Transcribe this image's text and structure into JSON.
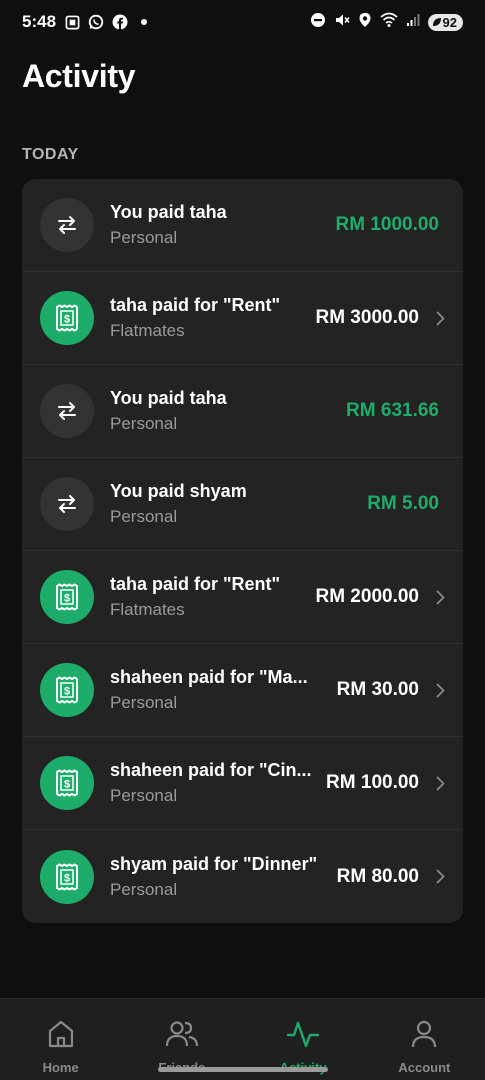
{
  "status_bar": {
    "time": "5:48",
    "battery": "92"
  },
  "page": {
    "title": "Activity",
    "section": "TODAY"
  },
  "colors": {
    "accent": "#1eac6a",
    "background": "#0f0f0f",
    "card": "#232323"
  },
  "activities": [
    {
      "icon": "transfer-icon",
      "title": "You paid taha",
      "subtitle": "Personal",
      "amount": "RM 1000.00",
      "amount_color": "green",
      "chevron": false
    },
    {
      "icon": "receipt-icon",
      "title": "taha paid for \"Rent\"",
      "subtitle": "Flatmates",
      "amount": "RM 3000.00",
      "amount_color": "white",
      "chevron": true
    },
    {
      "icon": "transfer-icon",
      "title": "You paid taha",
      "subtitle": "Personal",
      "amount": "RM 631.66",
      "amount_color": "green",
      "chevron": false
    },
    {
      "icon": "transfer-icon",
      "title": "You paid shyam",
      "subtitle": "Personal",
      "amount": "RM 5.00",
      "amount_color": "green",
      "chevron": false
    },
    {
      "icon": "receipt-icon",
      "title": "taha paid for \"Rent\"",
      "subtitle": "Flatmates",
      "amount": "RM 2000.00",
      "amount_color": "white",
      "chevron": true
    },
    {
      "icon": "receipt-icon",
      "title": "shaheen paid for \"Ma...",
      "subtitle": "Personal",
      "amount": "RM 30.00",
      "amount_color": "white",
      "chevron": true
    },
    {
      "icon": "receipt-icon",
      "title": "shaheen paid for \"Cin...",
      "subtitle": "Personal",
      "amount": "RM 100.00",
      "amount_color": "white",
      "chevron": true
    },
    {
      "icon": "receipt-icon",
      "title": "shyam paid for \"Dinner\"",
      "subtitle": "Personal",
      "amount": "RM 80.00",
      "amount_color": "white",
      "chevron": true
    }
  ],
  "nav": [
    {
      "label": "Home",
      "icon": "home-icon",
      "active": false
    },
    {
      "label": "Friends",
      "icon": "friends-icon",
      "active": false
    },
    {
      "label": "Activity",
      "icon": "activity-icon",
      "active": true
    },
    {
      "label": "Account",
      "icon": "account-icon",
      "active": false
    }
  ]
}
